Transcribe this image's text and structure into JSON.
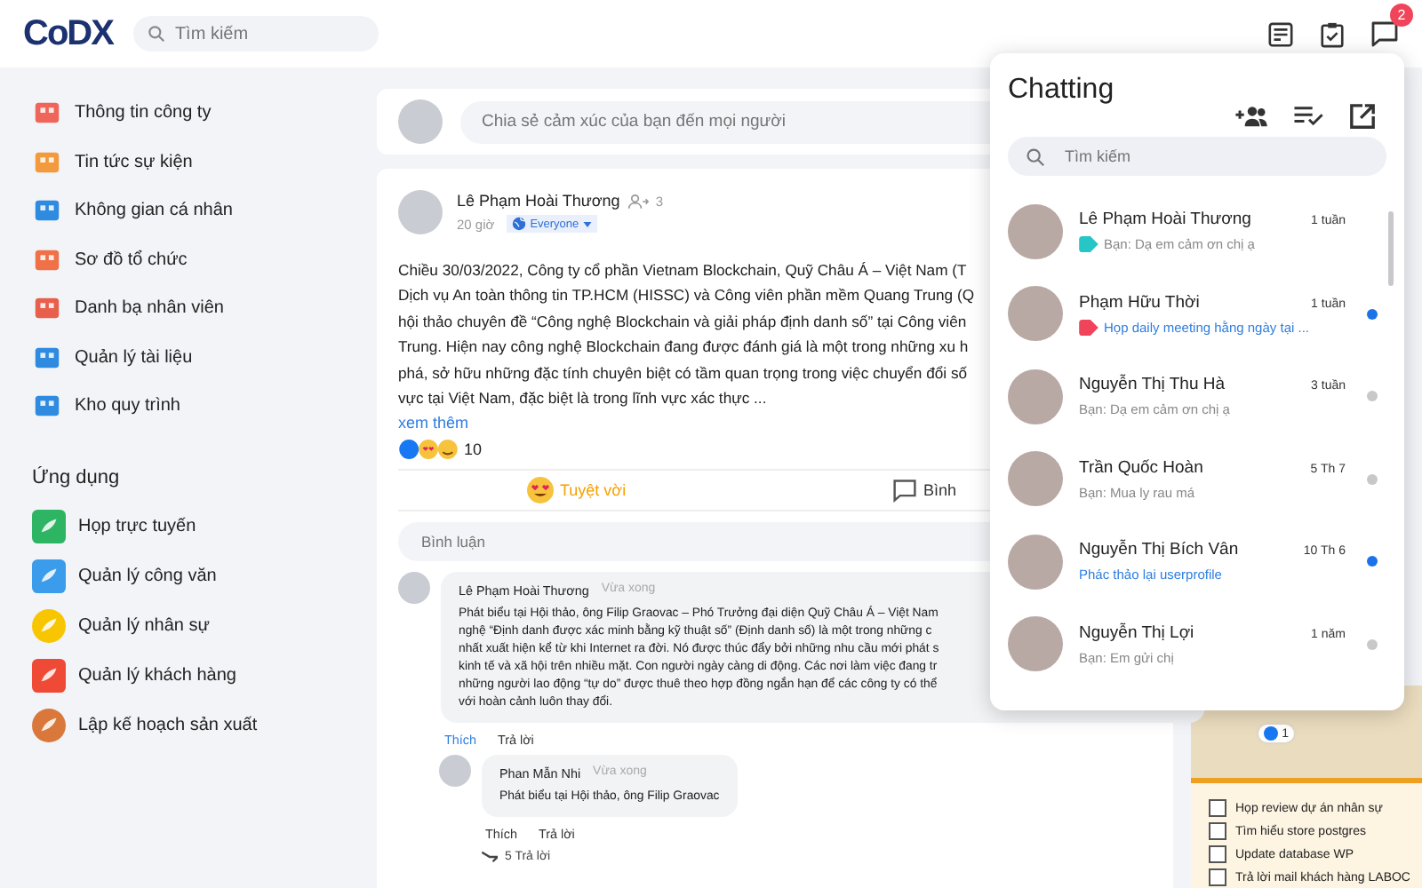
{
  "header": {
    "logo": "CoDX",
    "search": {
      "placeholder": "Tìm kiếm"
    },
    "chat_badge": "2"
  },
  "sidebar": {
    "items": [
      {
        "label": "Thông tin công ty"
      },
      {
        "label": "Tin tức sự kiện"
      },
      {
        "label": "Không gian cá nhân"
      },
      {
        "label": "Sơ đồ tổ chức"
      },
      {
        "label": "Danh bạ nhân viên"
      },
      {
        "label": "Quản lý tài liệu"
      },
      {
        "label": "Kho quy trình"
      }
    ],
    "apps_heading": "Ứng dụng",
    "apps": [
      {
        "label": "Họp trực tuyến"
      },
      {
        "label": "Quản lý công văn"
      },
      {
        "label": "Quản lý nhân sự"
      },
      {
        "label": "Quản lý khách hàng"
      },
      {
        "label": "Lập kế hoạch sản xuất"
      }
    ]
  },
  "composer": {
    "placeholder": "Chia sẻ cảm xúc của bạn đến mọi người"
  },
  "post": {
    "author": "Lê Phạm Hoài Thương",
    "followers": "3",
    "time": "20 giờ",
    "audience": "Everyone",
    "body_lines": [
      "Chiều 30/03/2022, Công ty cổ phần Vietnam Blockchain, Quỹ Châu Á – Việt Nam (T",
      "Dịch vụ An toàn thông tin TP.HCM (HISSC) và Công viên phần mềm Quang Trung (Q",
      "hội thảo chuyên đề “Công nghệ Blockchain và giải pháp định danh số” tại Công viên",
      "Trung. Hiện nay công nghệ Blockchain đang được đánh giá là một trong những xu h",
      "phá, sở hữu những đặc tính chuyên biệt có tầm quan trọng trong việc chuyển đổi số",
      "vực tại Việt Nam, đặc biệt là trong lĩnh vực xác thực ..."
    ],
    "see_more": "xem thêm",
    "reaction_count": "10",
    "react_label": "Tuyệt vời",
    "comment_label": "Bình",
    "comment_placeholder": "Bình luận",
    "comments": [
      {
        "author": "Lê Phạm Hoài Thương",
        "time": "Vừa xong",
        "lines": [
          "Phát biểu tại Hội thảo, ông Filip Graovac – Phó Trưởng đại diện Quỹ Châu Á – Việt Nam",
          "nghệ “Định danh được xác minh bằng kỹ thuật số” (Định danh số) là một trong những c",
          "nhất xuất hiện kể từ khi Internet ra đời. Nó được thúc đẩy bởi những nhu cầu mới phát s",
          "kinh tế và xã hội trên nhiều mặt. Con người ngày càng di động. Các nơi làm việc đang tr",
          "những người lao động “tự do” được thuê theo hợp đồng ngắn hạn để các công ty có thể",
          "với hoàn cảnh luôn thay đổi."
        ],
        "like": "Thích",
        "liked": true,
        "reply": "Trả lời",
        "like_count": "1"
      },
      {
        "author": "Phan Mẫn Nhi",
        "time": "Vừa xong",
        "lines": [
          "Phát biểu tại Hội thảo, ông Filip Graovac"
        ],
        "like": "Thích",
        "liked": false,
        "reply": "Trả lời",
        "replies": "5 Trả lời"
      }
    ]
  },
  "notes": [
    {
      "label": "Họp review dự án nhân sự",
      "checked": false
    },
    {
      "label": "Tìm hiểu store postgres",
      "checked": false
    },
    {
      "label": "Update database WP",
      "checked": false
    },
    {
      "label": "Trả lời mail khách hàng LABOC",
      "checked": false
    }
  ],
  "chat": {
    "title": "Chatting",
    "search": {
      "placeholder": "Tìm kiếm"
    },
    "items": [
      {
        "name": "Lê Phạm Hoài Thương",
        "time": "1 tuần",
        "preview": "Bạn: Dạ em cảm ơn chị ạ",
        "color": "#26c6c6",
        "unread": false,
        "dot_shown": false
      },
      {
        "name": "Phạm Hữu Thời",
        "time": "1 tuần",
        "preview": "Họp daily meeting hằng ngày tại ...",
        "color": "#f0445a",
        "unread": true,
        "dot_shown": true
      },
      {
        "name": "Nguyễn Thị Thu Hà",
        "time": "3 tuần",
        "preview": "Bạn: Dạ em cảm ơn chị ạ",
        "unread": false,
        "dot_shown": true
      },
      {
        "name": "Trần Quốc Hoàn",
        "time": "5 Th 7",
        "preview": "Bạn: Mua ly rau má",
        "unread": false,
        "dot_shown": true
      },
      {
        "name": "Nguyễn Thị Bích Vân",
        "time": "10 Th 6",
        "preview": "Phác thảo lại userprofile",
        "unread": true,
        "dot_shown": true
      },
      {
        "name": "Nguyễn Thị Lợi",
        "time": "1 năm",
        "preview": "Bạn: Em gửi chị",
        "unread": false,
        "dot_shown": true
      }
    ]
  }
}
